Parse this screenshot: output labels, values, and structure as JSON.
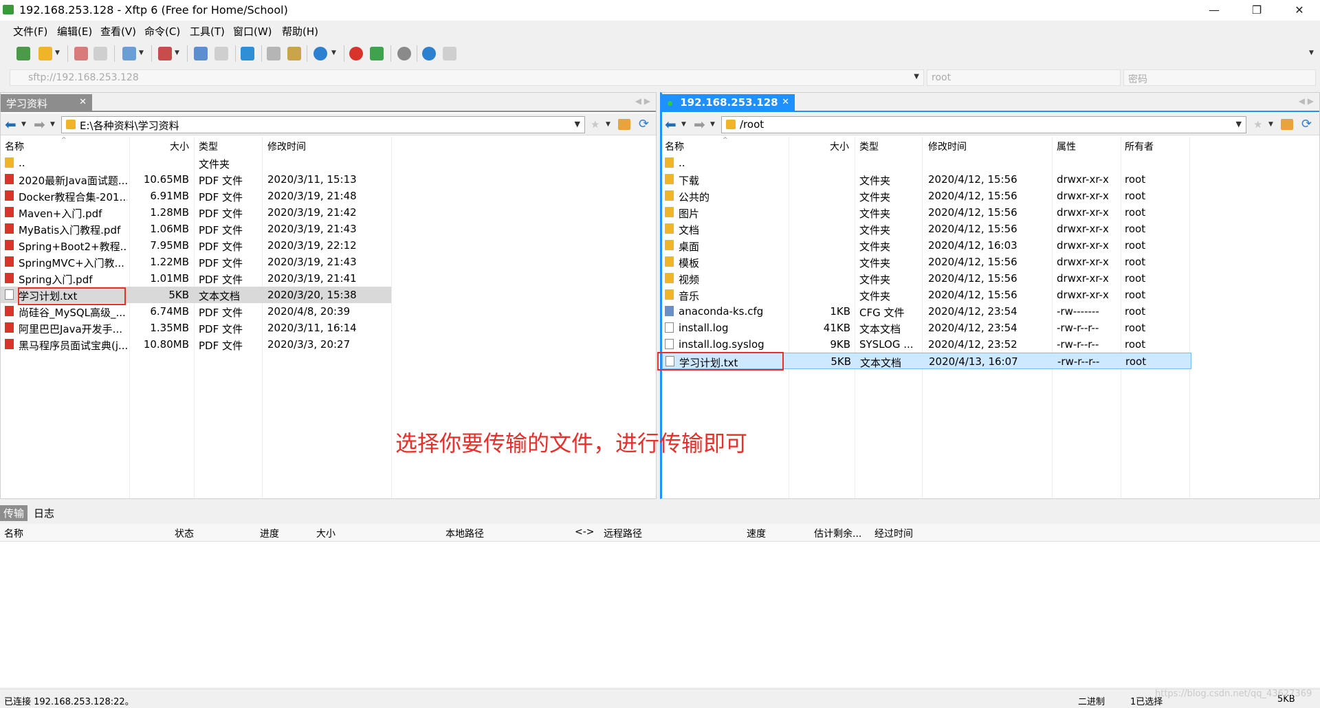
{
  "window": {
    "title": "192.168.253.128 - Xftp 6 (Free for Home/School)",
    "minimize": "—",
    "restore": "❐",
    "close": "✕"
  },
  "menu": [
    "文件(F)",
    "编辑(E)",
    "查看(V)",
    "命令(C)",
    "工具(T)",
    "窗口(W)",
    "帮助(H)"
  ],
  "address": {
    "url": "sftp://192.168.253.128",
    "user": "root",
    "password_placeholder": "密码"
  },
  "left_pane": {
    "tab_label": "学习资料",
    "path": "E:\\各种资料\\学习资料",
    "columns": [
      "名称",
      "大小",
      "类型",
      "修改时间"
    ],
    "rows": [
      {
        "name": "..",
        "size": "",
        "type": "文件夹",
        "modified": "",
        "icon": "folder-icon"
      },
      {
        "name": "2020最新Java面试题...",
        "size": "10.65MB",
        "type": "PDF 文件",
        "modified": "2020/3/11, 15:13",
        "icon": "pdf-icon"
      },
      {
        "name": "Docker教程合集-201...",
        "size": "6.91MB",
        "type": "PDF 文件",
        "modified": "2020/3/19, 21:48",
        "icon": "pdf-icon"
      },
      {
        "name": "Maven+入门.pdf",
        "size": "1.28MB",
        "type": "PDF 文件",
        "modified": "2020/3/19, 21:42",
        "icon": "pdf-icon"
      },
      {
        "name": "MyBatis入门教程.pdf",
        "size": "1.06MB",
        "type": "PDF 文件",
        "modified": "2020/3/19, 21:43",
        "icon": "pdf-icon"
      },
      {
        "name": "Spring+Boot2+教程...",
        "size": "7.95MB",
        "type": "PDF 文件",
        "modified": "2020/3/19, 22:12",
        "icon": "pdf-icon"
      },
      {
        "name": "SpringMVC+入门教...",
        "size": "1.22MB",
        "type": "PDF 文件",
        "modified": "2020/3/19, 21:43",
        "icon": "pdf-icon"
      },
      {
        "name": "Spring入门.pdf",
        "size": "1.01MB",
        "type": "PDF 文件",
        "modified": "2020/3/19, 21:41",
        "icon": "pdf-icon"
      },
      {
        "name": "学习计划.txt",
        "size": "5KB",
        "type": "文本文档",
        "modified": "2020/3/20, 15:38",
        "icon": "txt-icon",
        "selected": true
      },
      {
        "name": "尚硅谷_MySQL高级_...",
        "size": "6.74MB",
        "type": "PDF 文件",
        "modified": "2020/4/8, 20:39",
        "icon": "pdf-icon"
      },
      {
        "name": "阿里巴巴Java开发手...",
        "size": "1.35MB",
        "type": "PDF 文件",
        "modified": "2020/3/11, 16:14",
        "icon": "pdf-icon"
      },
      {
        "name": "黑马程序员面试宝典(j...",
        "size": "10.80MB",
        "type": "PDF 文件",
        "modified": "2020/3/3, 20:27",
        "icon": "pdf-icon"
      }
    ]
  },
  "right_pane": {
    "tab_label": "192.168.253.128",
    "path": "/root",
    "columns": [
      "名称",
      "大小",
      "类型",
      "修改时间",
      "属性",
      "所有者"
    ],
    "rows": [
      {
        "name": "..",
        "size": "",
        "type": "",
        "modified": "",
        "attrs": "",
        "owner": "",
        "icon": "folder-icon"
      },
      {
        "name": "下载",
        "size": "",
        "type": "文件夹",
        "modified": "2020/4/12, 15:56",
        "attrs": "drwxr-xr-x",
        "owner": "root",
        "icon": "folder-icon"
      },
      {
        "name": "公共的",
        "size": "",
        "type": "文件夹",
        "modified": "2020/4/12, 15:56",
        "attrs": "drwxr-xr-x",
        "owner": "root",
        "icon": "folder-icon"
      },
      {
        "name": "图片",
        "size": "",
        "type": "文件夹",
        "modified": "2020/4/12, 15:56",
        "attrs": "drwxr-xr-x",
        "owner": "root",
        "icon": "folder-icon"
      },
      {
        "name": "文档",
        "size": "",
        "type": "文件夹",
        "modified": "2020/4/12, 15:56",
        "attrs": "drwxr-xr-x",
        "owner": "root",
        "icon": "folder-icon"
      },
      {
        "name": "桌面",
        "size": "",
        "type": "文件夹",
        "modified": "2020/4/12, 16:03",
        "attrs": "drwxr-xr-x",
        "owner": "root",
        "icon": "folder-icon"
      },
      {
        "name": "模板",
        "size": "",
        "type": "文件夹",
        "modified": "2020/4/12, 15:56",
        "attrs": "drwxr-xr-x",
        "owner": "root",
        "icon": "folder-icon"
      },
      {
        "name": "视频",
        "size": "",
        "type": "文件夹",
        "modified": "2020/4/12, 15:56",
        "attrs": "drwxr-xr-x",
        "owner": "root",
        "icon": "folder-icon"
      },
      {
        "name": "音乐",
        "size": "",
        "type": "文件夹",
        "modified": "2020/4/12, 15:56",
        "attrs": "drwxr-xr-x",
        "owner": "root",
        "icon": "folder-icon"
      },
      {
        "name": "anaconda-ks.cfg",
        "size": "1KB",
        "type": "CFG 文件",
        "modified": "2020/4/12, 23:54",
        "attrs": "-rw-------",
        "owner": "root",
        "icon": "cfg-icon"
      },
      {
        "name": "install.log",
        "size": "41KB",
        "type": "文本文档",
        "modified": "2020/4/12, 23:54",
        "attrs": "-rw-r--r--",
        "owner": "root",
        "icon": "txt-icon"
      },
      {
        "name": "install.log.syslog",
        "size": "9KB",
        "type": "SYSLOG ...",
        "modified": "2020/4/12, 23:52",
        "attrs": "-rw-r--r--",
        "owner": "root",
        "icon": "txt-icon"
      },
      {
        "name": "学习计划.txt",
        "size": "5KB",
        "type": "文本文档",
        "modified": "2020/4/13, 16:07",
        "attrs": "-rw-r--r--",
        "owner": "root",
        "icon": "txt-icon",
        "selected": true
      }
    ]
  },
  "annotation": "选择你要传输的文件，进行传输即可",
  "bottom_tabs": [
    "传输",
    "日志"
  ],
  "transfer_columns": [
    "名称",
    "状态",
    "进度",
    "大小",
    "本地路径",
    "<->",
    "远程路径",
    "速度",
    "估计剩余...",
    "经过时间"
  ],
  "status": {
    "connection": "已连接 192.168.253.128:22。",
    "mode": "二进制",
    "selection": "1已选择",
    "size": "5KB"
  },
  "watermark": "https://blog.csdn.net/qq_43627369",
  "colors": {
    "accent": "#1e90ff",
    "annotation_red": "#e8302b",
    "tab_gray": "#8d8d8d"
  }
}
